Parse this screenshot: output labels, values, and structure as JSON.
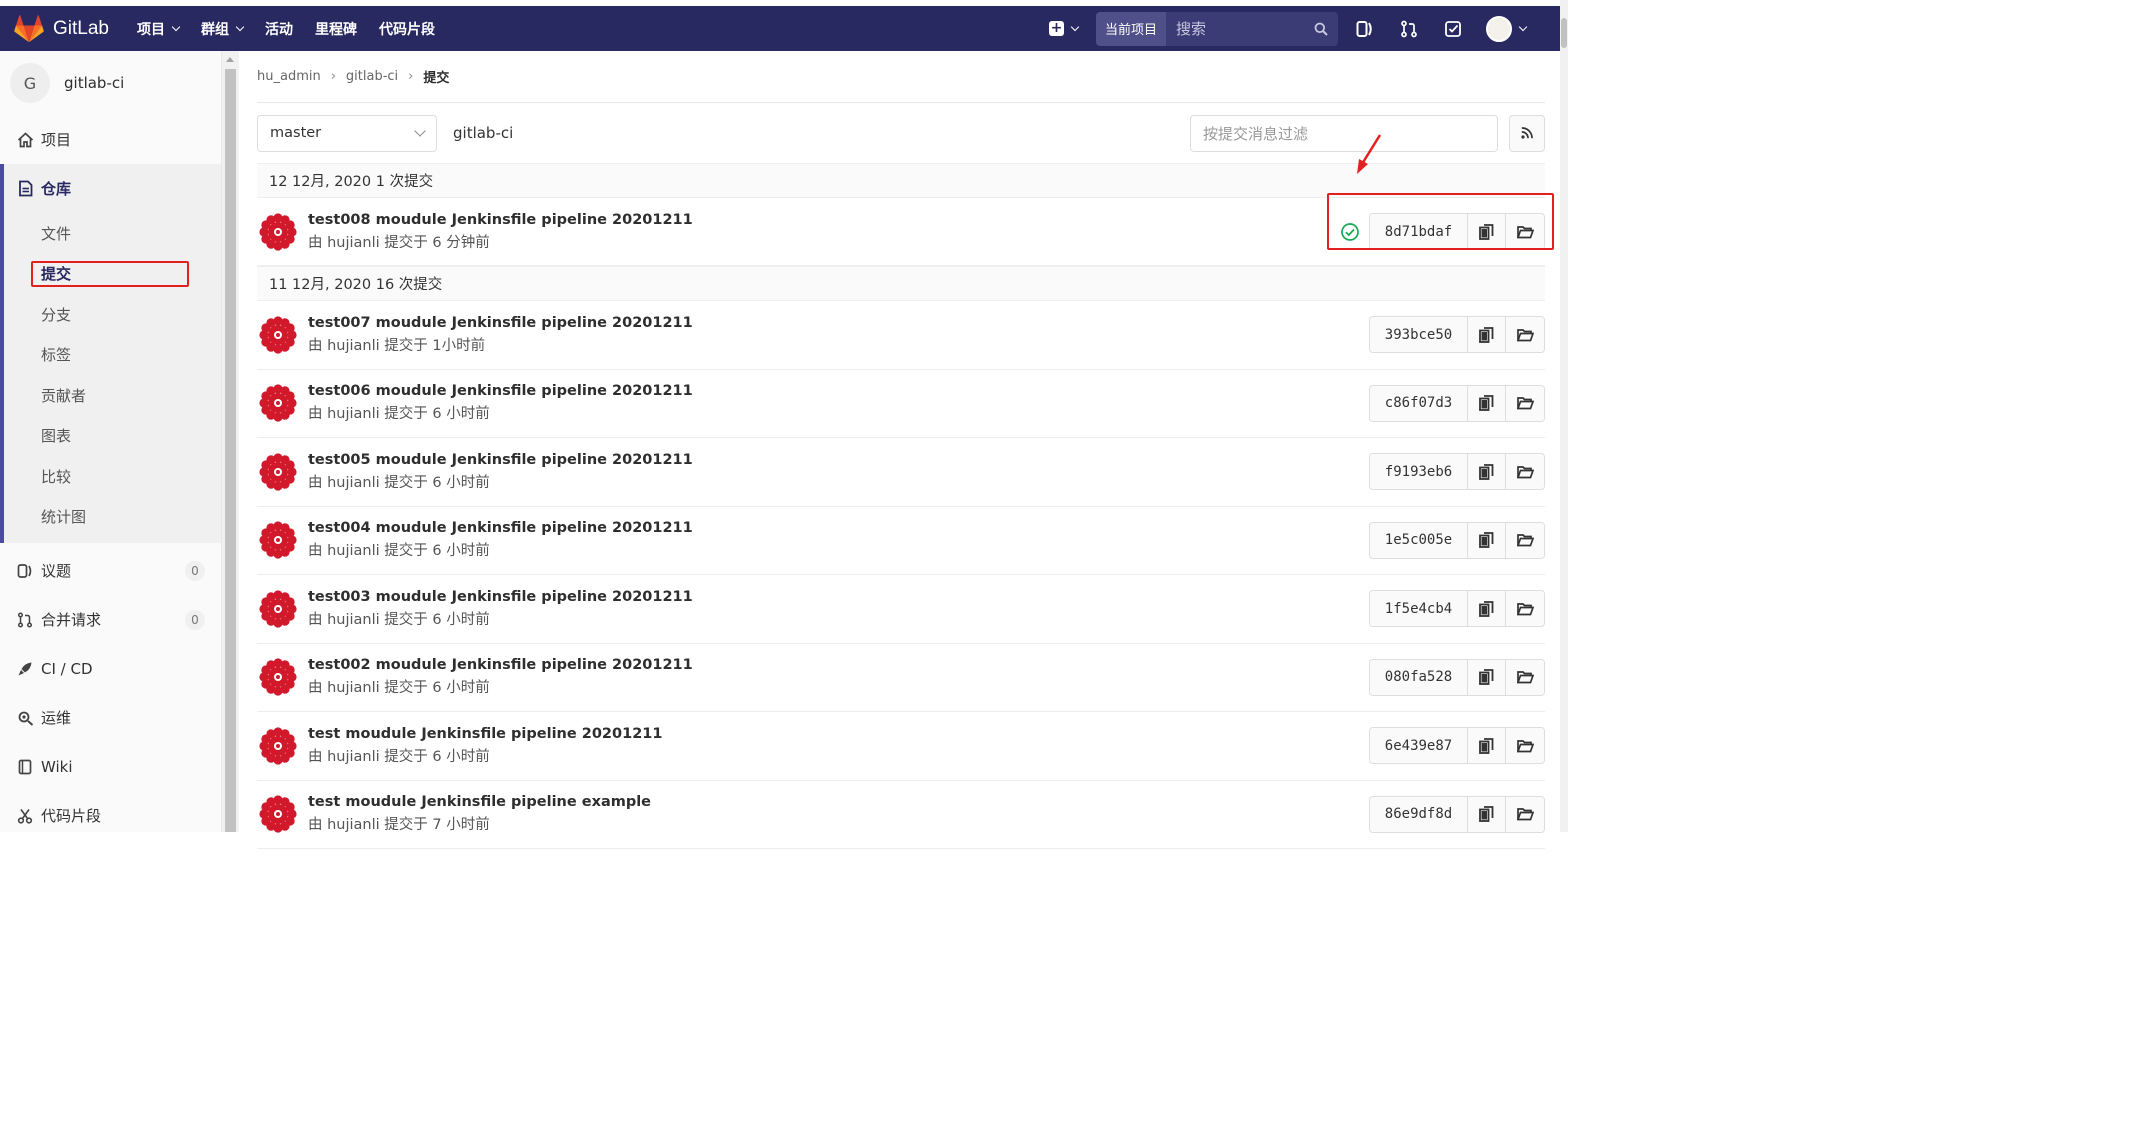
{
  "navbar": {
    "brand": "GitLab",
    "menu": [
      {
        "label": "项目",
        "dropdown": true
      },
      {
        "label": "群组",
        "dropdown": true
      },
      {
        "label": "活动",
        "dropdown": false
      },
      {
        "label": "里程碑",
        "dropdown": false
      },
      {
        "label": "代码片段",
        "dropdown": false
      }
    ],
    "search_scope": "当前项目",
    "search_placeholder": "搜索",
    "bg_color": "#292961"
  },
  "sidebar": {
    "project_initial": "G",
    "project_name": "gitlab-ci",
    "items": [
      {
        "label": "项目",
        "icon": "home-icon"
      },
      {
        "label": "仓库",
        "icon": "repository-icon",
        "active": true
      },
      {
        "label": "议题",
        "icon": "issues-icon",
        "badge": "0"
      },
      {
        "label": "合并请求",
        "icon": "merge-request-icon",
        "badge": "0"
      },
      {
        "label": "CI / CD",
        "icon": "rocket-icon"
      },
      {
        "label": "运维",
        "icon": "operations-icon"
      },
      {
        "label": "Wiki",
        "icon": "book-icon"
      },
      {
        "label": "代码片段",
        "icon": "snippet-icon"
      }
    ],
    "repo_sub": [
      "文件",
      "提交",
      "分支",
      "标签",
      "贡献者",
      "图表",
      "比较",
      "统计图"
    ],
    "active_sub": "提交"
  },
  "breadcrumb": [
    "hu_admin",
    "gitlab-ci",
    "提交"
  ],
  "toolbar": {
    "branch": "master",
    "path": "gitlab-ci",
    "filter_placeholder": "按提交消息过滤"
  },
  "commit_groups": [
    {
      "date_label": "12 12月, 2020 1 次提交",
      "commits": [
        {
          "title": "test008 moudule Jenkinsfile pipeline 20201211",
          "meta": "由 hujianli 提交于 6 分钟前",
          "sha": "8d71bdaf",
          "pipeline": "passed"
        }
      ]
    },
    {
      "date_label": "11 12月, 2020 16 次提交",
      "commits": [
        {
          "title": "test007 moudule Jenkinsfile pipeline 20201211",
          "meta": "由 hujianli 提交于 1小时前",
          "sha": "393bce50"
        },
        {
          "title": "test006 moudule Jenkinsfile pipeline 20201211",
          "meta": "由 hujianli 提交于 6 小时前",
          "sha": "c86f07d3"
        },
        {
          "title": "test005 moudule Jenkinsfile pipeline 20201211",
          "meta": "由 hujianli 提交于 6 小时前",
          "sha": "f9193eb6"
        },
        {
          "title": "test004 moudule Jenkinsfile pipeline 20201211",
          "meta": "由 hujianli 提交于 6 小时前",
          "sha": "1e5c005e"
        },
        {
          "title": "test003 moudule Jenkinsfile pipeline 20201211",
          "meta": "由 hujianli 提交于 6 小时前",
          "sha": "1f5e4cb4"
        },
        {
          "title": "test002 moudule Jenkinsfile pipeline 20201211",
          "meta": "由 hujianli 提交于 6 小时前",
          "sha": "080fa528"
        },
        {
          "title": "test moudule Jenkinsfile pipeline 20201211",
          "meta": "由 hujianli 提交于 6 小时前",
          "sha": "6e439e87"
        },
        {
          "title": "test moudule Jenkinsfile pipeline example",
          "meta": "由 hujianli 提交于 7 小时前",
          "sha": "86e9df8d"
        }
      ]
    }
  ],
  "colors": {
    "accent": "#292961",
    "annotation": "#e32020",
    "pipeline_ok": "#1aaa55",
    "avatar": "#d2192b"
  }
}
